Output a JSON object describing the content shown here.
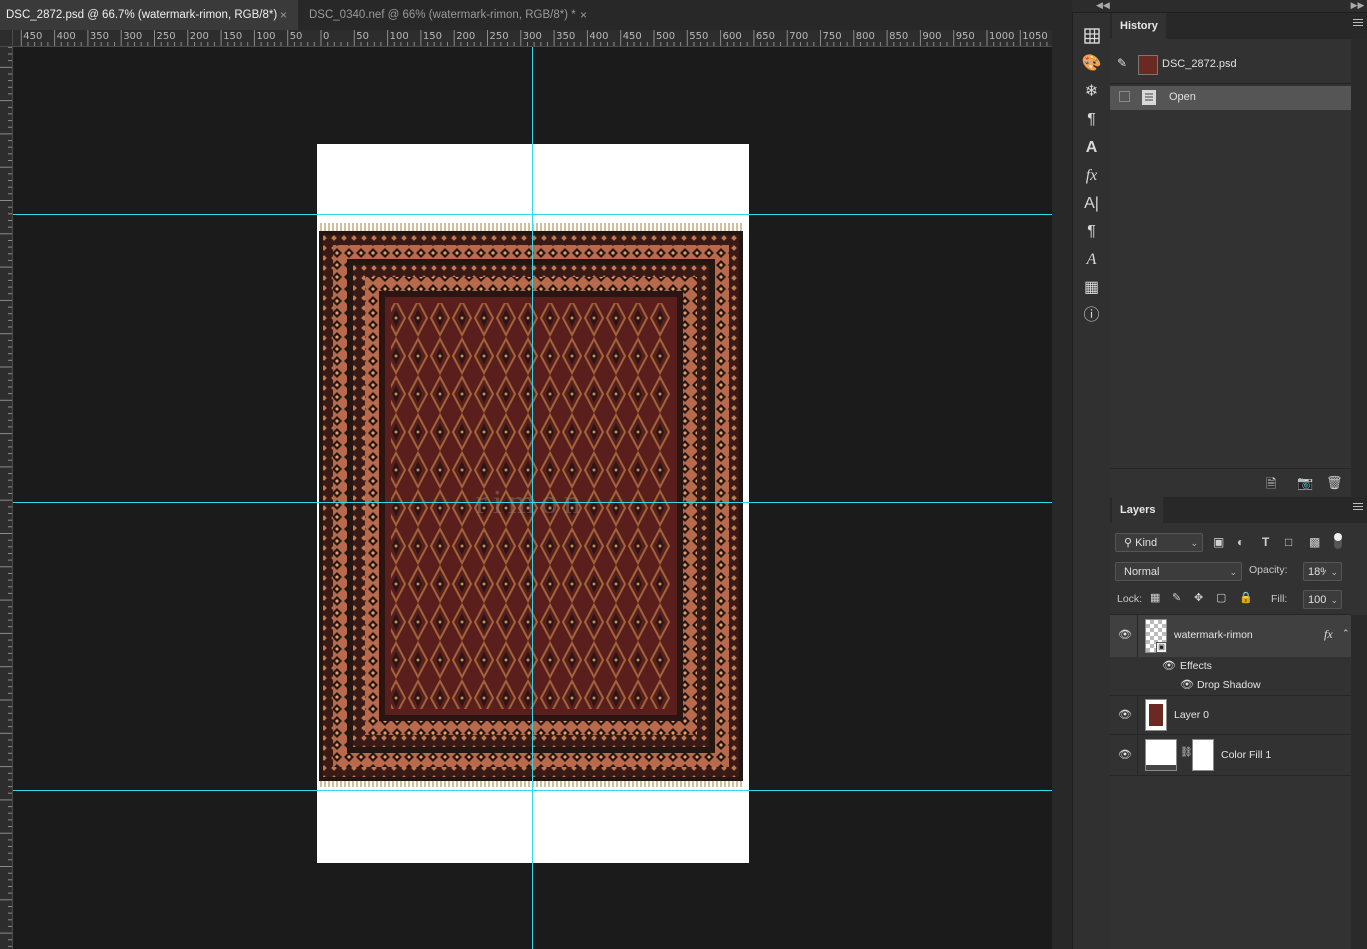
{
  "tabs": [
    {
      "label": "DSC_2872.psd @ 66.7% (watermark-rimon, RGB/8*)",
      "close": "×",
      "active": true
    },
    {
      "label": "DSC_0340.nef @ 66% (watermark-rimon, RGB/8*) *",
      "close": "×",
      "active": false
    }
  ],
  "ruler": {
    "h_labels": [
      "450",
      "400",
      "350",
      "300",
      "250",
      "200",
      "150",
      "100",
      "50",
      "0",
      "50",
      "100",
      "150",
      "200",
      "250",
      "300",
      "350",
      "400",
      "450",
      "500",
      "550",
      "600",
      "650",
      "700",
      "750",
      "800",
      "850",
      "900",
      "950",
      "1000",
      "1050"
    ]
  },
  "canvas": {
    "watermark_text": "rimon",
    "guide_color": "#37d8ea",
    "rug_colors": {
      "field": "#5a1f1c",
      "border": "#b96a4c",
      "dark": "#241611",
      "fringe": "#c9a77b",
      "motif": "#a0643a"
    }
  },
  "icon_strip": [
    "grid-icon",
    "palette-icon",
    "snowflake-icon",
    "paragraph-style-icon",
    "character-style-icon",
    "fx-icon",
    "character-icon",
    "paragraph-icon",
    "glyphs-icon",
    "3d-icon",
    "info-icon"
  ],
  "history": {
    "title": "History",
    "snapshot_label": "DSC_2872.psd",
    "items": [
      {
        "label": "Open",
        "selected": true
      }
    ],
    "footer_icons": [
      "new-document-from-state-icon",
      "camera-icon",
      "trash-icon"
    ]
  },
  "layers": {
    "title": "Layers",
    "filter_kind": "Kind",
    "blend_mode": "Normal",
    "opacity_label": "Opacity:",
    "opacity_value": "18%",
    "lock_label": "Lock:",
    "fill_label": "Fill:",
    "fill_value": "100%",
    "rows": [
      {
        "name": "watermark-rimon",
        "fx": "fx",
        "selected": true
      },
      {
        "effects_label": "Effects"
      },
      {
        "effect_name": "Drop Shadow"
      },
      {
        "name": "Layer 0"
      },
      {
        "name": "Color Fill 1"
      }
    ]
  }
}
